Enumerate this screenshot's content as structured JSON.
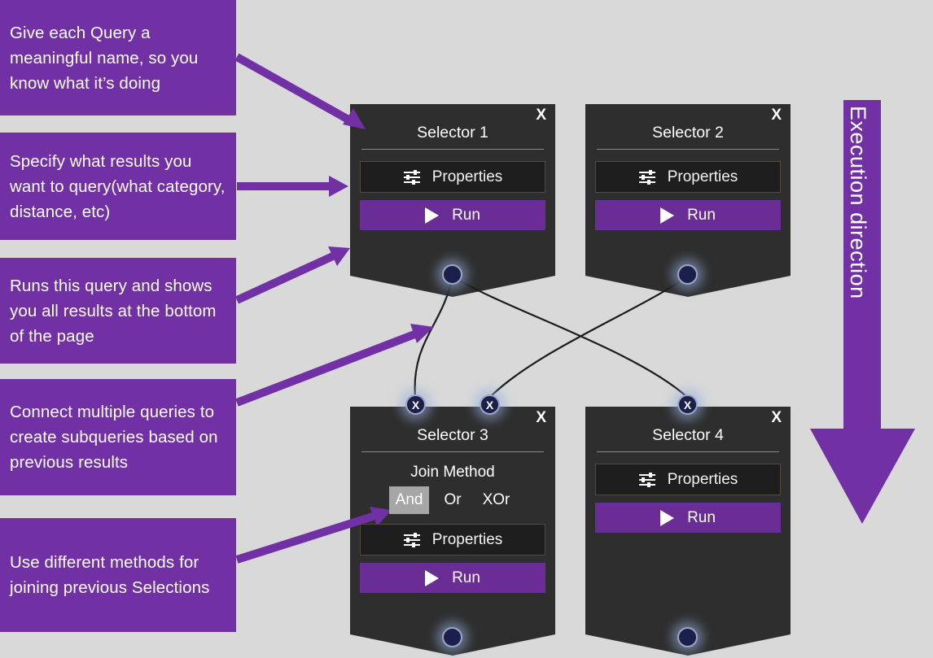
{
  "callouts": [
    {
      "id": "name-query",
      "text": "Give each Query a meaningful name, so you know what it’s doing"
    },
    {
      "id": "specify-results",
      "text": "Specify what results you want to query(what category, distance, etc)"
    },
    {
      "id": "run-query",
      "text": "Runs this query and shows you all results at the bottom of the page"
    },
    {
      "id": "connect-queries",
      "text": "Connect multiple queries to create subqueries based on previous results"
    },
    {
      "id": "join-methods",
      "text": "Use different methods for joining previous Selections"
    }
  ],
  "execution": {
    "label": "Execution direction"
  },
  "nodes": [
    {
      "id": "selector-1",
      "title": "Selector 1",
      "close": "X",
      "properties_label": "Properties",
      "run_label": "Run",
      "output_port": "",
      "input_ports": []
    },
    {
      "id": "selector-2",
      "title": "Selector 2",
      "close": "X",
      "properties_label": "Properties",
      "run_label": "Run",
      "output_port": "",
      "input_ports": []
    },
    {
      "id": "selector-3",
      "title": "Selector 3",
      "close": "X",
      "join_label": "Join Method",
      "join_options": [
        "And",
        "Or",
        "XOr"
      ],
      "join_selected": "And",
      "properties_label": "Properties",
      "run_label": "Run",
      "output_port": "",
      "input_ports": [
        "X",
        "X"
      ]
    },
    {
      "id": "selector-4",
      "title": "Selector 4",
      "close": "X",
      "properties_label": "Properties",
      "run_label": "Run",
      "output_port": "",
      "input_ports": [
        "X"
      ]
    }
  ],
  "colors": {
    "accent_purple": "#7130A3",
    "run_purple": "#6A2D95",
    "node_bg": "#2e2e2e",
    "canvas_bg": "#d9d9d9",
    "props_bg": "#1e1e1e",
    "port_fill": "#1b1f4a",
    "join_selected_bg": "#a6a6a6"
  },
  "icons": {
    "properties": "tune-icon",
    "run": "play-icon",
    "close": "close-icon"
  }
}
